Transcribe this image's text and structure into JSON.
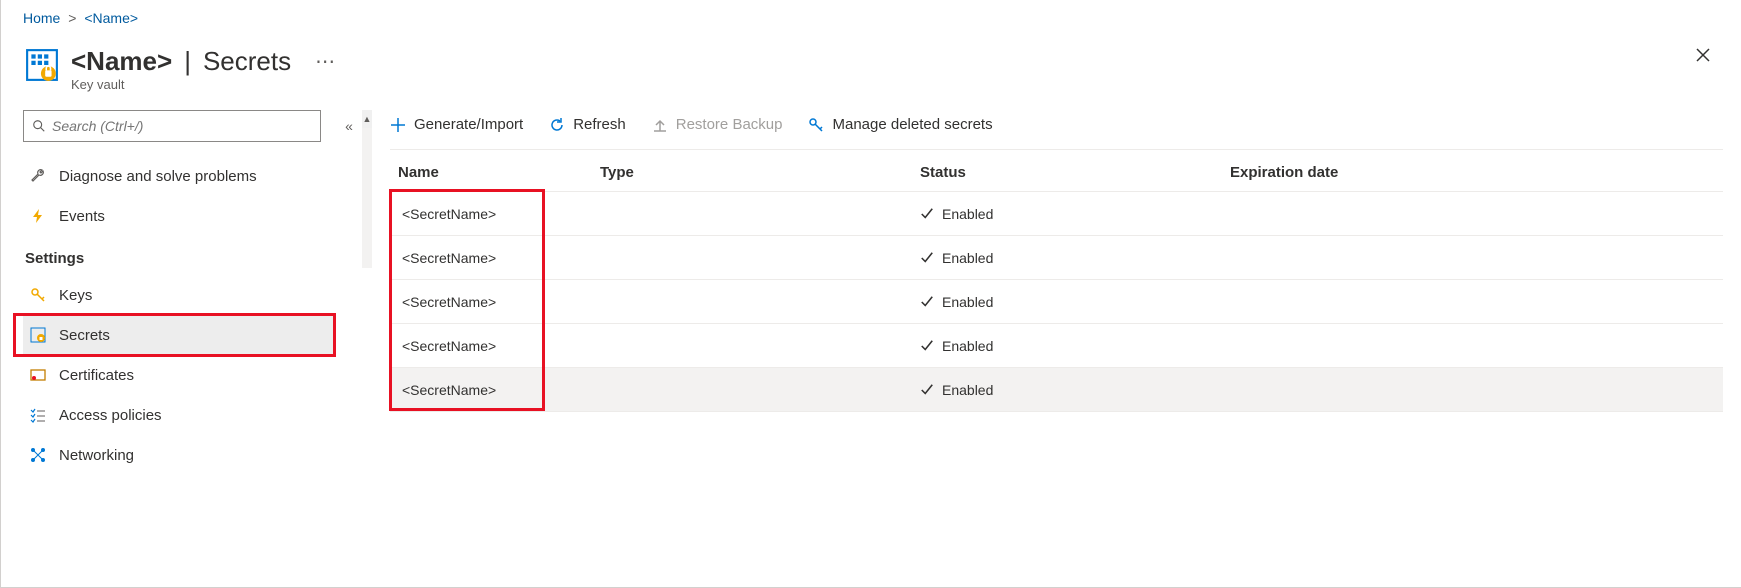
{
  "breadcrumb": {
    "home": "Home",
    "name": "<Name>"
  },
  "header": {
    "title_bold": "<Name>",
    "title_light": "Secrets",
    "subtitle": "Key vault"
  },
  "search": {
    "placeholder": "Search (Ctrl+/)"
  },
  "sidebar": {
    "diagnose": "Diagnose and solve problems",
    "events": "Events",
    "section_settings": "Settings",
    "keys": "Keys",
    "secrets": "Secrets",
    "certificates": "Certificates",
    "access_policies": "Access policies",
    "networking": "Networking"
  },
  "toolbar": {
    "generate": "Generate/Import",
    "refresh": "Refresh",
    "restore": "Restore Backup",
    "manage_deleted": "Manage deleted secrets"
  },
  "table": {
    "headers": {
      "name": "Name",
      "type": "Type",
      "status": "Status",
      "expiration": "Expiration date"
    },
    "enabled_label": "Enabled",
    "rows": [
      {
        "name": "<SecretName>",
        "type": "",
        "status": "Enabled",
        "expiration": ""
      },
      {
        "name": "<SecretName>",
        "type": "",
        "status": "Enabled",
        "expiration": ""
      },
      {
        "name": "<SecretName>",
        "type": "",
        "status": "Enabled",
        "expiration": ""
      },
      {
        "name": "<SecretName>",
        "type": "",
        "status": "Enabled",
        "expiration": ""
      },
      {
        "name": "<SecretName>",
        "type": "",
        "status": "Enabled",
        "expiration": ""
      }
    ]
  }
}
